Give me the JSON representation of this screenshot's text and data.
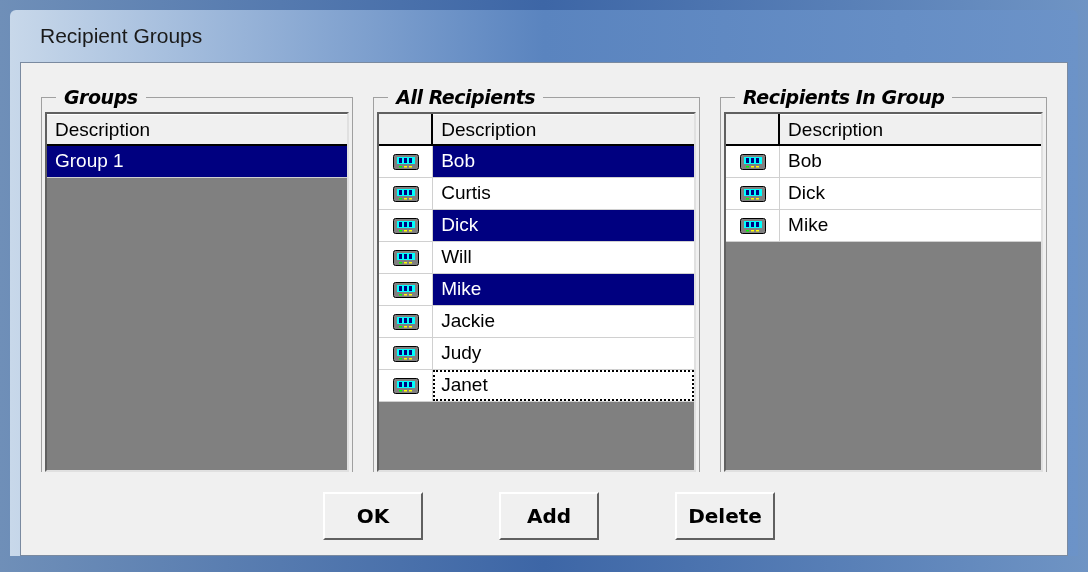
{
  "window": {
    "title": "Recipient Groups"
  },
  "groups": {
    "title": "Groups",
    "columns": [
      "Description"
    ],
    "rows": [
      {
        "description": "Group 1",
        "selected": true
      }
    ]
  },
  "all_recipients": {
    "title": "All Recipients",
    "columns": [
      "Description"
    ],
    "rows": [
      {
        "description": "Bob",
        "selected": true,
        "focused": false
      },
      {
        "description": "Curtis",
        "selected": false,
        "focused": false
      },
      {
        "description": "Dick",
        "selected": true,
        "focused": false
      },
      {
        "description": "Will",
        "selected": false,
        "focused": false
      },
      {
        "description": "Mike",
        "selected": true,
        "focused": false
      },
      {
        "description": "Jackie",
        "selected": false,
        "focused": false
      },
      {
        "description": "Judy",
        "selected": false,
        "focused": false
      },
      {
        "description": "Janet",
        "selected": false,
        "focused": true
      }
    ]
  },
  "recipients_in_group": {
    "title": "Recipients In Group",
    "columns": [
      "Description"
    ],
    "rows": [
      {
        "description": "Bob",
        "selected": false
      },
      {
        "description": "Dick",
        "selected": false
      },
      {
        "description": "Mike",
        "selected": false
      }
    ]
  },
  "buttons": [
    "OK",
    "Add",
    "Delete"
  ]
}
